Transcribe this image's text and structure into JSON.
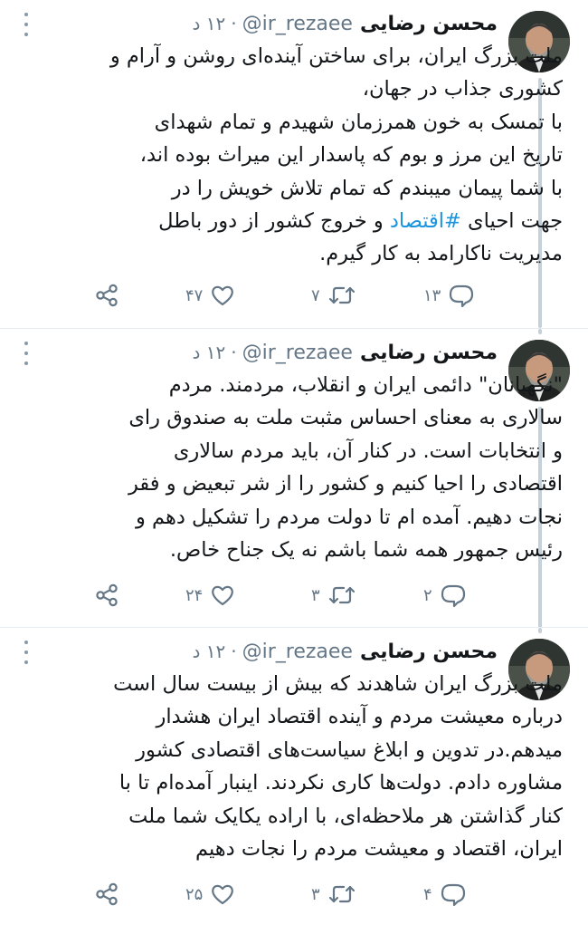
{
  "tweets": [
    {
      "name": "محسن رضایی",
      "handle": "@ir_rezaee",
      "time": "۱۲ د",
      "lines": [
        "ملت بزرگ ایران، برای ساختن آینده‌ای روشن و آرام و",
        "کشوری جذاب در جهان،",
        "با تمسک به خون همرزمان شهیدم و تمام شهدای",
        "تاریخ این مرز و بوم که پاسدار این میراث بوده اند،",
        "با شما پیمان میبندم که تمام تلاش خویش را در"
      ],
      "hashtag_line": {
        "before": "جهت احیای ",
        "tag": "#اقتصاد",
        "after": " و خروج کشور از دور باطل"
      },
      "last_line": "مدیریت ناکارامد به کار گیرم.",
      "counts": {
        "reply": "۱۳",
        "retweet": "۷",
        "like": "۴۷"
      }
    },
    {
      "name": "محسن رضایی",
      "handle": "@ir_rezaee",
      "time": "۱۲ د",
      "lines": [
        "\"نگهبانان\" دائمی ایران و انقلاب، مردمند. مردم",
        "سالاری به معنای احساس مثبت ملت به صندوق رای",
        "و انتخابات است. در کنار آن، باید مردم سالاری",
        "اقتصادی را احیا کنیم و کشور را از شر تبعیض و فقر",
        "نجات دهیم. آمده ام تا دولت مردم را تشکیل دهم و",
        "رئیس جمهور همه شما باشم نه یک جناح خاص."
      ],
      "counts": {
        "reply": "۲",
        "retweet": "۳",
        "like": "۲۴"
      }
    },
    {
      "name": "محسن رضایی",
      "handle": "@ir_rezaee",
      "time": "۱۲ د",
      "lines": [
        "ملت بزرگ ایران شاهدند که بیش از بیست سال است",
        "درباره معیشت مردم و آینده اقتصاد ایران هشدار",
        "میدهم.در تدوین و ابلاغ سیاست‌های اقتصادی کشور",
        "مشاوره دادم. دولت‌ها کاری نکردند. اینبار آمده‌ام تا با",
        "کنار گذاشتن هر ملاحظه‌ای، با اراده یکایک شما ملت",
        "ایران، اقتصاد و معیشت مردم را نجات دهیم"
      ],
      "counts": {
        "reply": "۴",
        "retweet": "۳",
        "like": "۲۵"
      }
    }
  ]
}
